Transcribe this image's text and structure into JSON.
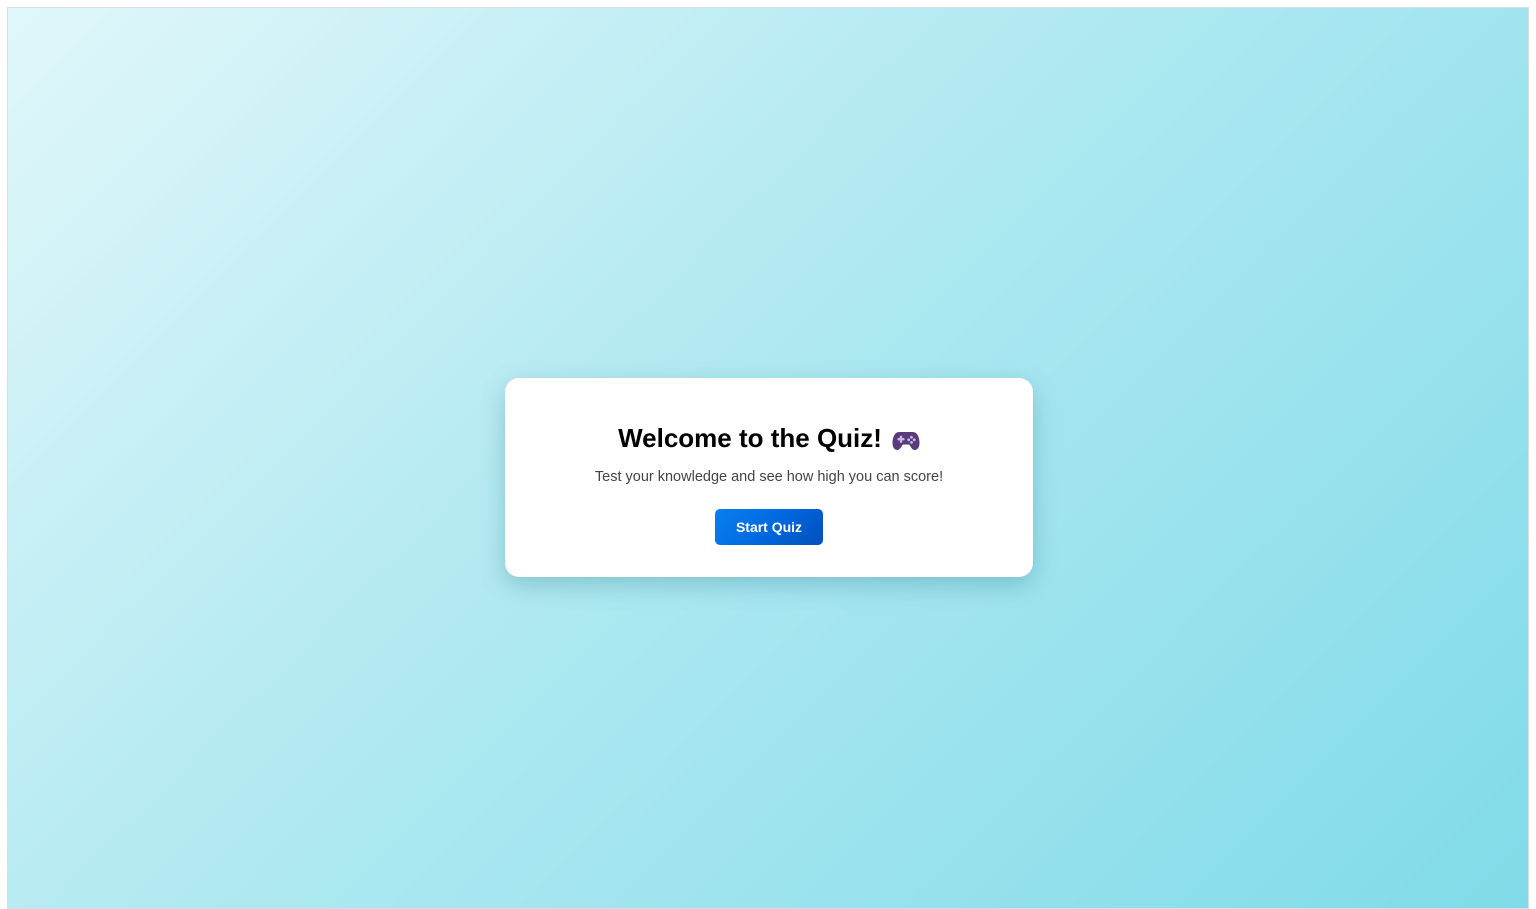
{
  "welcome": {
    "title": "Welcome to the Quiz!",
    "title_icon": "game-controller-icon",
    "subtitle": "Test your knowledge and see how high you can score!",
    "start_button_label": "Start Quiz"
  },
  "colors": {
    "background_gradient_start": "#e0f7fa",
    "background_gradient_end": "#80dbe8",
    "card_background": "#ffffff",
    "button_background": "#0a80f0",
    "button_text": "#ffffff",
    "controller_icon": "#5a3a78"
  }
}
